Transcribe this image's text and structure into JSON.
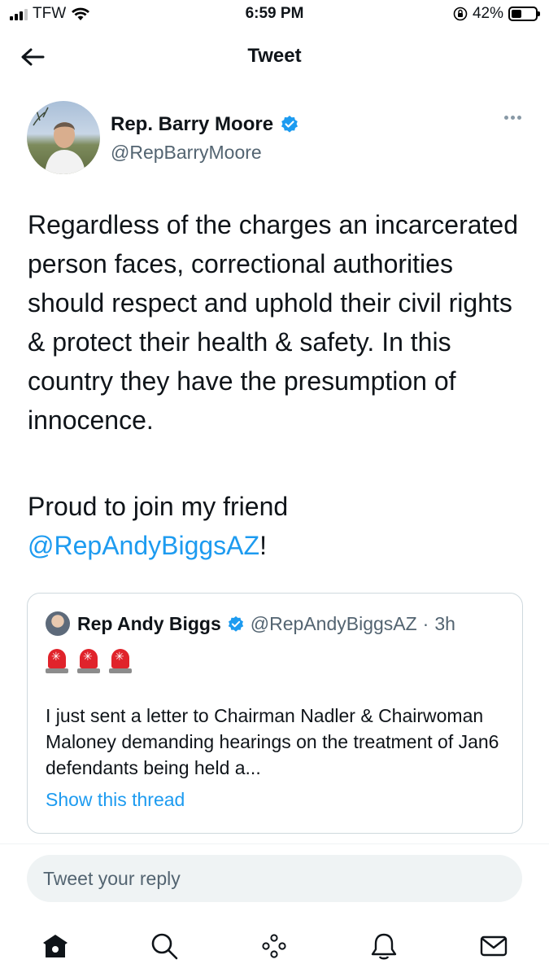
{
  "status_bar": {
    "carrier": "TFW",
    "time": "6:59 PM",
    "battery_percent": "42%",
    "battery_level": 0.42,
    "signal_bars": 3
  },
  "header": {
    "title": "Tweet",
    "back_icon": "arrow-left-icon"
  },
  "tweet": {
    "author_name": "Rep. Barry Moore",
    "author_handle": "@RepBarryMoore",
    "verified": true,
    "text_paragraph_1": "Regardless of the charges an incarcerated person faces, correctional authorities should respect and uphold their civil rights & protect their health & safety. In this country they have the presumption of innocence.",
    "text_paragraph_2_prefix": "Proud to join my friend ",
    "text_paragraph_2_mention": "@RepAndyBiggsAZ",
    "text_paragraph_2_suffix": "!"
  },
  "quoted_tweet": {
    "author_name": "Rep Andy Biggs",
    "author_handle": "@RepAndyBiggsAZ",
    "separator": "·",
    "time_ago": "3h",
    "verified": true,
    "emoji": [
      "siren-icon",
      "siren-icon",
      "siren-icon"
    ],
    "text": "I just sent a letter to Chairman Nadler & Chairwoman Maloney demanding hearings on the treatment of Jan6 defendants being held a...",
    "show_thread_label": "Show this thread"
  },
  "reply": {
    "placeholder": "Tweet your reply"
  },
  "tab_bar": {
    "items": [
      "home-icon",
      "search-icon",
      "spaces-icon",
      "notifications-icon",
      "messages-icon"
    ]
  },
  "colors": {
    "link_blue": "#1d9bf0",
    "secondary_text": "#536471",
    "border": "#cfd9de"
  }
}
